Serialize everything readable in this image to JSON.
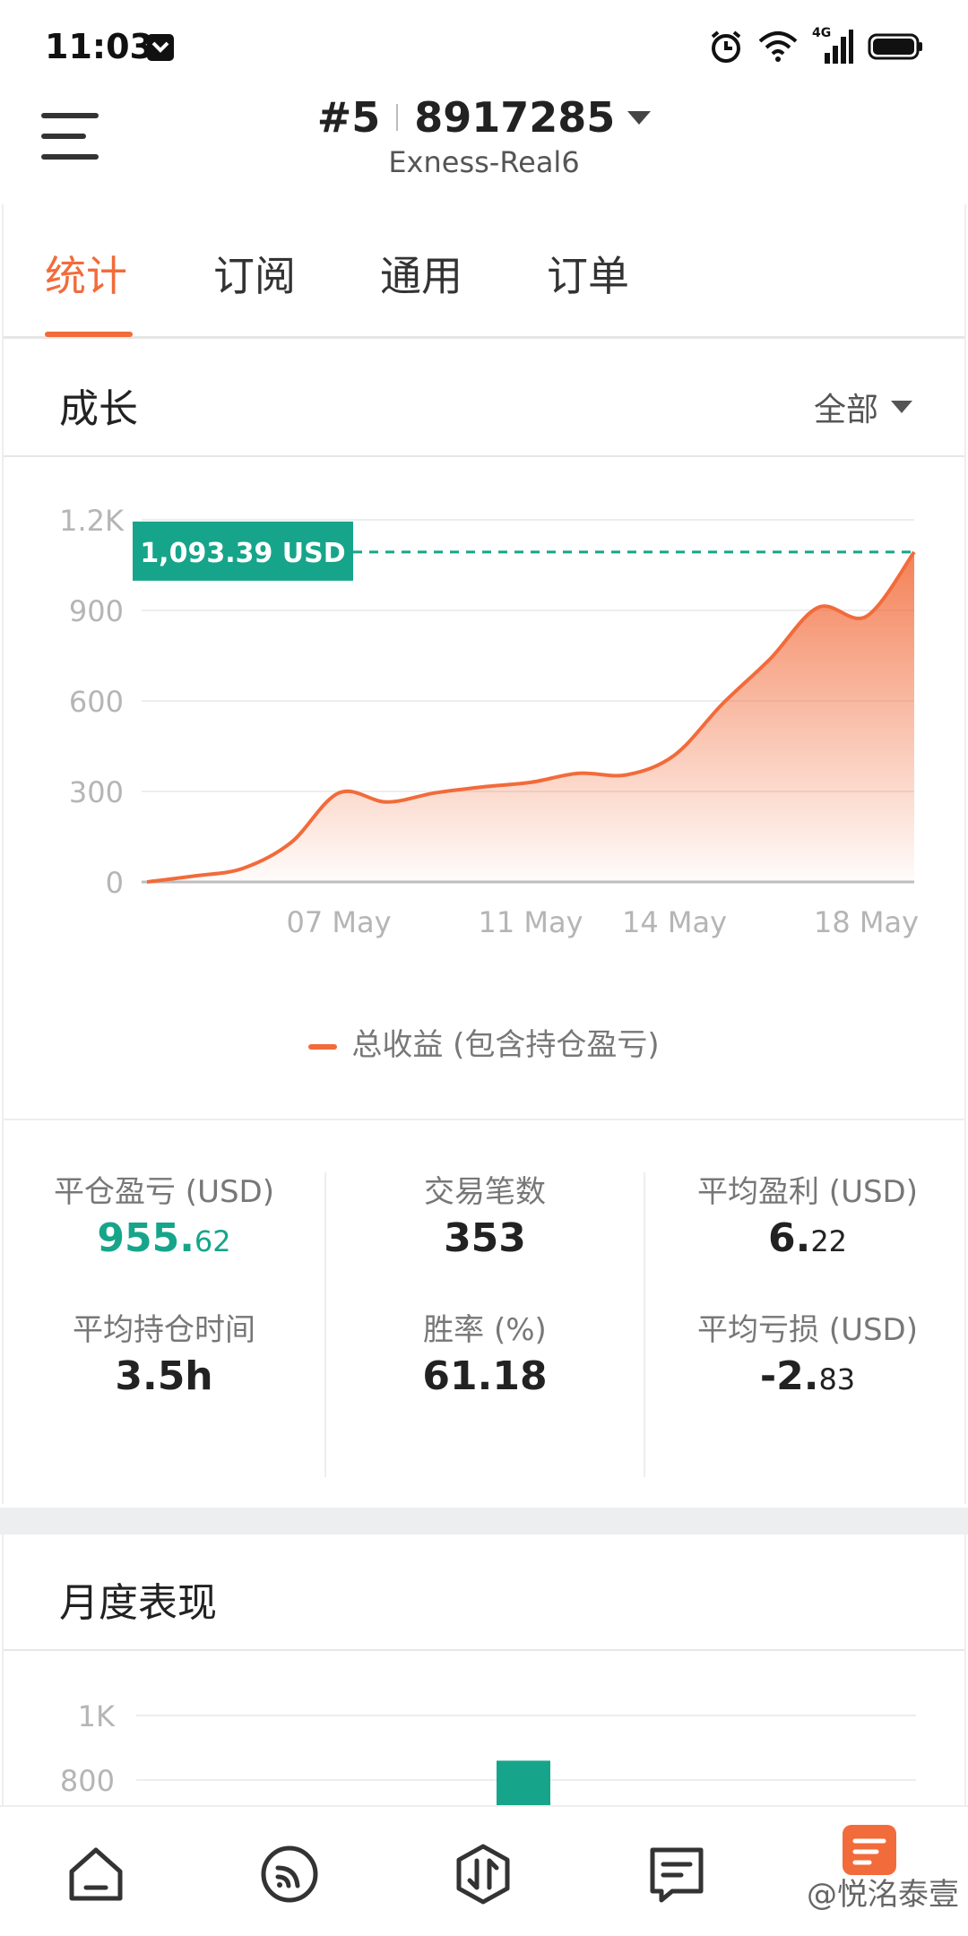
{
  "status": {
    "time": "11:03",
    "network": "4G"
  },
  "header": {
    "account_num": "#5",
    "account_id": "8917285",
    "server": "Exness-Real6"
  },
  "tabs": [
    {
      "label": "统计",
      "active": true
    },
    {
      "label": "订阅",
      "active": false
    },
    {
      "label": "通用",
      "active": false
    },
    {
      "label": "订单",
      "active": false
    }
  ],
  "growth": {
    "title": "成长",
    "range": "全部"
  },
  "chart_data": {
    "type": "area",
    "x": [
      "2024-05-03",
      "2024-05-04",
      "2024-05-05",
      "2024-05-06",
      "2024-05-07",
      "2024-05-08",
      "2024-05-09",
      "2024-05-10",
      "2024-05-11",
      "2024-05-12",
      "2024-05-13",
      "2024-05-14",
      "2024-05-15",
      "2024-05-16",
      "2024-05-17",
      "2024-05-18",
      "2024-05-19"
    ],
    "series": [
      {
        "name": "总收益 (包含持仓盈亏)",
        "values": [
          0,
          20,
          45,
          130,
          295,
          265,
          295,
          315,
          330,
          360,
          355,
          420,
          590,
          740,
          910,
          880,
          1093.39
        ]
      }
    ],
    "tick_labels_x": [
      "07 May",
      "11 May",
      "14 May",
      "18 May"
    ],
    "tick_labels_y": [
      "0",
      "300",
      "600",
      "900",
      "1.2K"
    ],
    "ylim": [
      0,
      1200
    ],
    "current_value_label": "1,093.39 USD",
    "legend": "总收益 (包含持仓盈亏)",
    "color": "#f26b3a",
    "marker_color": "#16a58a",
    "grid": true
  },
  "stats": [
    [
      {
        "label": "平仓盈亏 (USD)",
        "int": "955.",
        "dec": "62",
        "green": true
      },
      {
        "label": "平均持仓时间",
        "int": "3.5h",
        "dec": ""
      }
    ],
    [
      {
        "label": "交易笔数",
        "int": "353",
        "dec": ""
      },
      {
        "label": "胜率 (%)",
        "int": "61.18",
        "dec": ""
      }
    ],
    [
      {
        "label": "平均盈利 (USD)",
        "int": "6.",
        "dec": "22"
      },
      {
        "label": "平均亏损 (USD)",
        "int": "-2.",
        "dec": "83"
      }
    ]
  ],
  "monthly": {
    "title": "月度表现",
    "tick_labels_y": [
      "1K",
      "800"
    ],
    "bar_value": 860,
    "ylim": [
      0,
      1000
    ],
    "bar_color": "#16a58a"
  },
  "nav": {
    "watermark": "@悦洺泰壹"
  }
}
